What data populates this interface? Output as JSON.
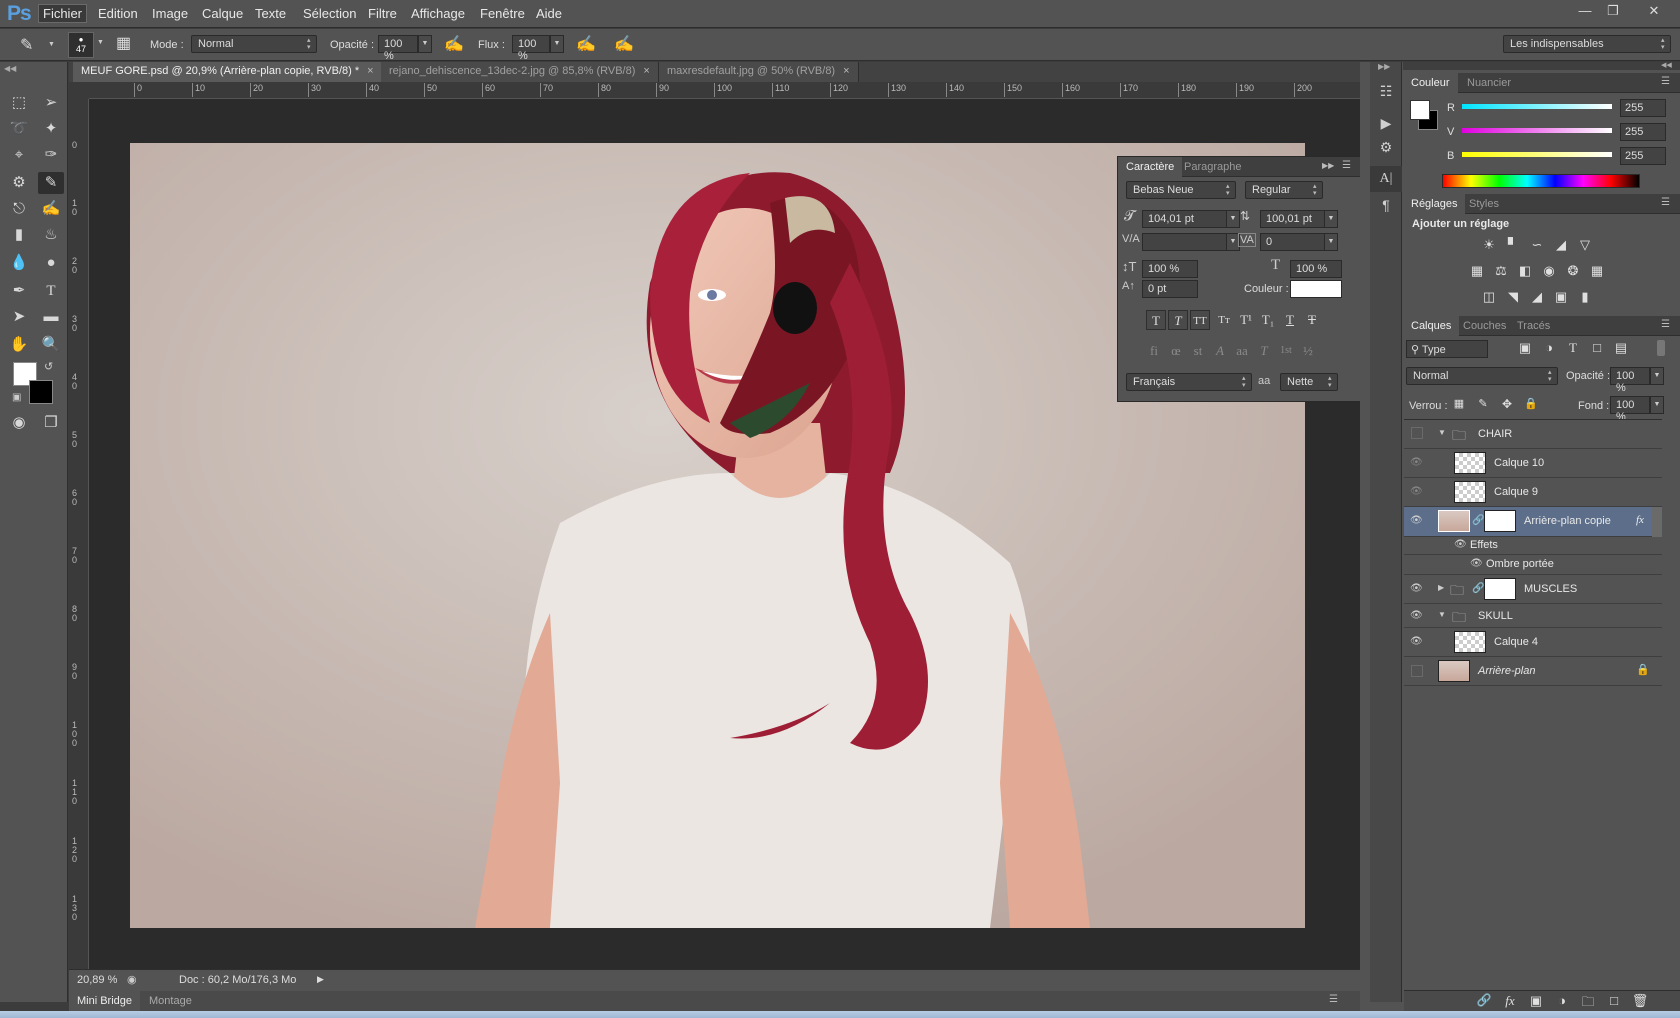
{
  "app": {
    "logo": "Ps"
  },
  "menu": [
    "Fichier",
    "Edition",
    "Image",
    "Calque",
    "Texte",
    "Sélection",
    "Filtre",
    "Affichage",
    "Fenêtre",
    "Aide"
  ],
  "window_controls": [
    "minimize",
    "restore",
    "close"
  ],
  "options_bar": {
    "brush_size": "47",
    "mode_label": "Mode :",
    "mode_value": "Normal",
    "opacity_label": "Opacité :",
    "opacity_value": "100 %",
    "flow_label": "Flux :",
    "flow_value": "100 %",
    "workspace": "Les indispensables"
  },
  "tabs": [
    {
      "label": "MEUF GORE.psd @ 20,9% (Arrière-plan copie, RVB/8) *",
      "active": true
    },
    {
      "label": "rejano_dehiscence_13dec-2.jpg @ 85,8% (RVB/8)",
      "active": false
    },
    {
      "label": "maxresdefault.jpg @ 50% (RVB/8)",
      "active": false
    }
  ],
  "ruler_h": [
    "0",
    "10",
    "20",
    "30",
    "40",
    "50",
    "60",
    "70",
    "80",
    "90",
    "100",
    "110",
    "120",
    "130",
    "140",
    "150",
    "160",
    "170",
    "180",
    "190",
    "200"
  ],
  "ruler_v": [
    "0",
    "1 0",
    "2 0",
    "3 0",
    "4 0",
    "5 0",
    "6 0",
    "7 0",
    "8 0",
    "9 0",
    "1 0 0",
    "1 1 0",
    "1 2 0",
    "1 3 0"
  ],
  "status": {
    "zoom": "20,89 %",
    "doc": "Doc : 60,2 Mo/176,3 Mo"
  },
  "bottom_tabs": [
    "Mini Bridge",
    "Montage"
  ],
  "character_panel": {
    "tabs": [
      "Caractère",
      "Paragraphe"
    ],
    "font_family": "Bebas Neue",
    "font_style": "Regular",
    "size": "104,01 pt",
    "leading": "100,01 pt",
    "kerning": "",
    "tracking": "0",
    "vscale": "100 %",
    "hscale": "100 %",
    "baseline": "0 pt",
    "color_label": "Couleur :",
    "language": "Français",
    "antialias_label": "aa",
    "antialias": "Nette"
  },
  "color_panel": {
    "tabs": [
      "Couleur",
      "Nuancier"
    ],
    "r_label": "R",
    "r": "255",
    "g_label": "V",
    "g": "255",
    "b_label": "B",
    "b": "255"
  },
  "adjust_panel": {
    "tabs": [
      "Réglages",
      "Styles"
    ],
    "title": "Ajouter un réglage"
  },
  "layers_panel": {
    "tabs": [
      "Calques",
      "Couches",
      "Tracés"
    ],
    "filter": "Type",
    "blend": "Normal",
    "opacity_label": "Opacité :",
    "opacity": "100 %",
    "lock_label": "Verrou :",
    "fill_label": "Fond :",
    "fill": "100 %",
    "layers": [
      {
        "name": "CHAIR",
        "type": "group",
        "visible": false
      },
      {
        "name": "Calque 10",
        "type": "layer",
        "visible": false
      },
      {
        "name": "Calque 9",
        "type": "layer",
        "visible": false
      },
      {
        "name": "Arrière-plan copie",
        "type": "layer",
        "visible": true,
        "selected": true
      },
      {
        "name": "Effets",
        "type": "effect"
      },
      {
        "name": "Ombre portée",
        "type": "effect"
      },
      {
        "name": "MUSCLES",
        "type": "group",
        "visible": true
      },
      {
        "name": "SKULL",
        "type": "group",
        "visible": true
      },
      {
        "name": "Calque 4",
        "type": "layer",
        "visible": true
      },
      {
        "name": "Arrière-plan",
        "type": "background",
        "visible": false
      }
    ]
  },
  "colors": {
    "ui_bg": "#535353",
    "accent_selected": "#5c6e8a",
    "hair": "#9e1f35"
  }
}
